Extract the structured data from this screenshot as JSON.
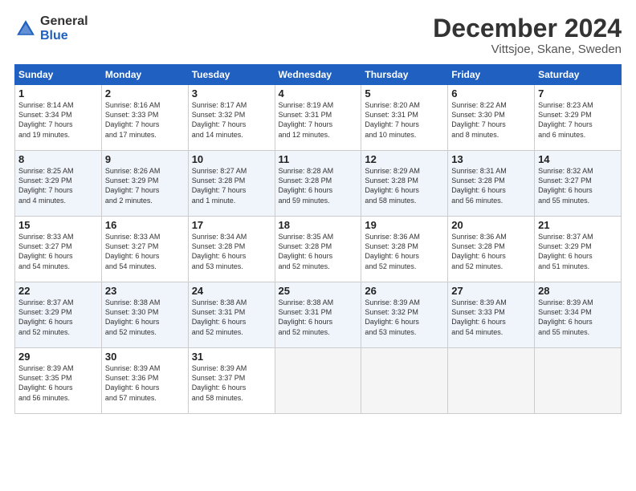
{
  "header": {
    "logo_general": "General",
    "logo_blue": "Blue",
    "month": "December 2024",
    "location": "Vittsjoe, Skane, Sweden"
  },
  "columns": [
    "Sunday",
    "Monday",
    "Tuesday",
    "Wednesday",
    "Thursday",
    "Friday",
    "Saturday"
  ],
  "weeks": [
    [
      {
        "day": "1",
        "info": "Sunrise: 8:14 AM\nSunset: 3:34 PM\nDaylight: 7 hours\nand 19 minutes."
      },
      {
        "day": "2",
        "info": "Sunrise: 8:16 AM\nSunset: 3:33 PM\nDaylight: 7 hours\nand 17 minutes."
      },
      {
        "day": "3",
        "info": "Sunrise: 8:17 AM\nSunset: 3:32 PM\nDaylight: 7 hours\nand 14 minutes."
      },
      {
        "day": "4",
        "info": "Sunrise: 8:19 AM\nSunset: 3:31 PM\nDaylight: 7 hours\nand 12 minutes."
      },
      {
        "day": "5",
        "info": "Sunrise: 8:20 AM\nSunset: 3:31 PM\nDaylight: 7 hours\nand 10 minutes."
      },
      {
        "day": "6",
        "info": "Sunrise: 8:22 AM\nSunset: 3:30 PM\nDaylight: 7 hours\nand 8 minutes."
      },
      {
        "day": "7",
        "info": "Sunrise: 8:23 AM\nSunset: 3:29 PM\nDaylight: 7 hours\nand 6 minutes."
      }
    ],
    [
      {
        "day": "8",
        "info": "Sunrise: 8:25 AM\nSunset: 3:29 PM\nDaylight: 7 hours\nand 4 minutes."
      },
      {
        "day": "9",
        "info": "Sunrise: 8:26 AM\nSunset: 3:29 PM\nDaylight: 7 hours\nand 2 minutes."
      },
      {
        "day": "10",
        "info": "Sunrise: 8:27 AM\nSunset: 3:28 PM\nDaylight: 7 hours\nand 1 minute."
      },
      {
        "day": "11",
        "info": "Sunrise: 8:28 AM\nSunset: 3:28 PM\nDaylight: 6 hours\nand 59 minutes."
      },
      {
        "day": "12",
        "info": "Sunrise: 8:29 AM\nSunset: 3:28 PM\nDaylight: 6 hours\nand 58 minutes."
      },
      {
        "day": "13",
        "info": "Sunrise: 8:31 AM\nSunset: 3:28 PM\nDaylight: 6 hours\nand 56 minutes."
      },
      {
        "day": "14",
        "info": "Sunrise: 8:32 AM\nSunset: 3:27 PM\nDaylight: 6 hours\nand 55 minutes."
      }
    ],
    [
      {
        "day": "15",
        "info": "Sunrise: 8:33 AM\nSunset: 3:27 PM\nDaylight: 6 hours\nand 54 minutes."
      },
      {
        "day": "16",
        "info": "Sunrise: 8:33 AM\nSunset: 3:27 PM\nDaylight: 6 hours\nand 54 minutes."
      },
      {
        "day": "17",
        "info": "Sunrise: 8:34 AM\nSunset: 3:28 PM\nDaylight: 6 hours\nand 53 minutes."
      },
      {
        "day": "18",
        "info": "Sunrise: 8:35 AM\nSunset: 3:28 PM\nDaylight: 6 hours\nand 52 minutes."
      },
      {
        "day": "19",
        "info": "Sunrise: 8:36 AM\nSunset: 3:28 PM\nDaylight: 6 hours\nand 52 minutes."
      },
      {
        "day": "20",
        "info": "Sunrise: 8:36 AM\nSunset: 3:28 PM\nDaylight: 6 hours\nand 52 minutes."
      },
      {
        "day": "21",
        "info": "Sunrise: 8:37 AM\nSunset: 3:29 PM\nDaylight: 6 hours\nand 51 minutes."
      }
    ],
    [
      {
        "day": "22",
        "info": "Sunrise: 8:37 AM\nSunset: 3:29 PM\nDaylight: 6 hours\nand 52 minutes."
      },
      {
        "day": "23",
        "info": "Sunrise: 8:38 AM\nSunset: 3:30 PM\nDaylight: 6 hours\nand 52 minutes."
      },
      {
        "day": "24",
        "info": "Sunrise: 8:38 AM\nSunset: 3:31 PM\nDaylight: 6 hours\nand 52 minutes."
      },
      {
        "day": "25",
        "info": "Sunrise: 8:38 AM\nSunset: 3:31 PM\nDaylight: 6 hours\nand 52 minutes."
      },
      {
        "day": "26",
        "info": "Sunrise: 8:39 AM\nSunset: 3:32 PM\nDaylight: 6 hours\nand 53 minutes."
      },
      {
        "day": "27",
        "info": "Sunrise: 8:39 AM\nSunset: 3:33 PM\nDaylight: 6 hours\nand 54 minutes."
      },
      {
        "day": "28",
        "info": "Sunrise: 8:39 AM\nSunset: 3:34 PM\nDaylight: 6 hours\nand 55 minutes."
      }
    ],
    [
      {
        "day": "29",
        "info": "Sunrise: 8:39 AM\nSunset: 3:35 PM\nDaylight: 6 hours\nand 56 minutes."
      },
      {
        "day": "30",
        "info": "Sunrise: 8:39 AM\nSunset: 3:36 PM\nDaylight: 6 hours\nand 57 minutes."
      },
      {
        "day": "31",
        "info": "Sunrise: 8:39 AM\nSunset: 3:37 PM\nDaylight: 6 hours\nand 58 minutes."
      },
      {
        "day": "",
        "info": ""
      },
      {
        "day": "",
        "info": ""
      },
      {
        "day": "",
        "info": ""
      },
      {
        "day": "",
        "info": ""
      }
    ]
  ]
}
